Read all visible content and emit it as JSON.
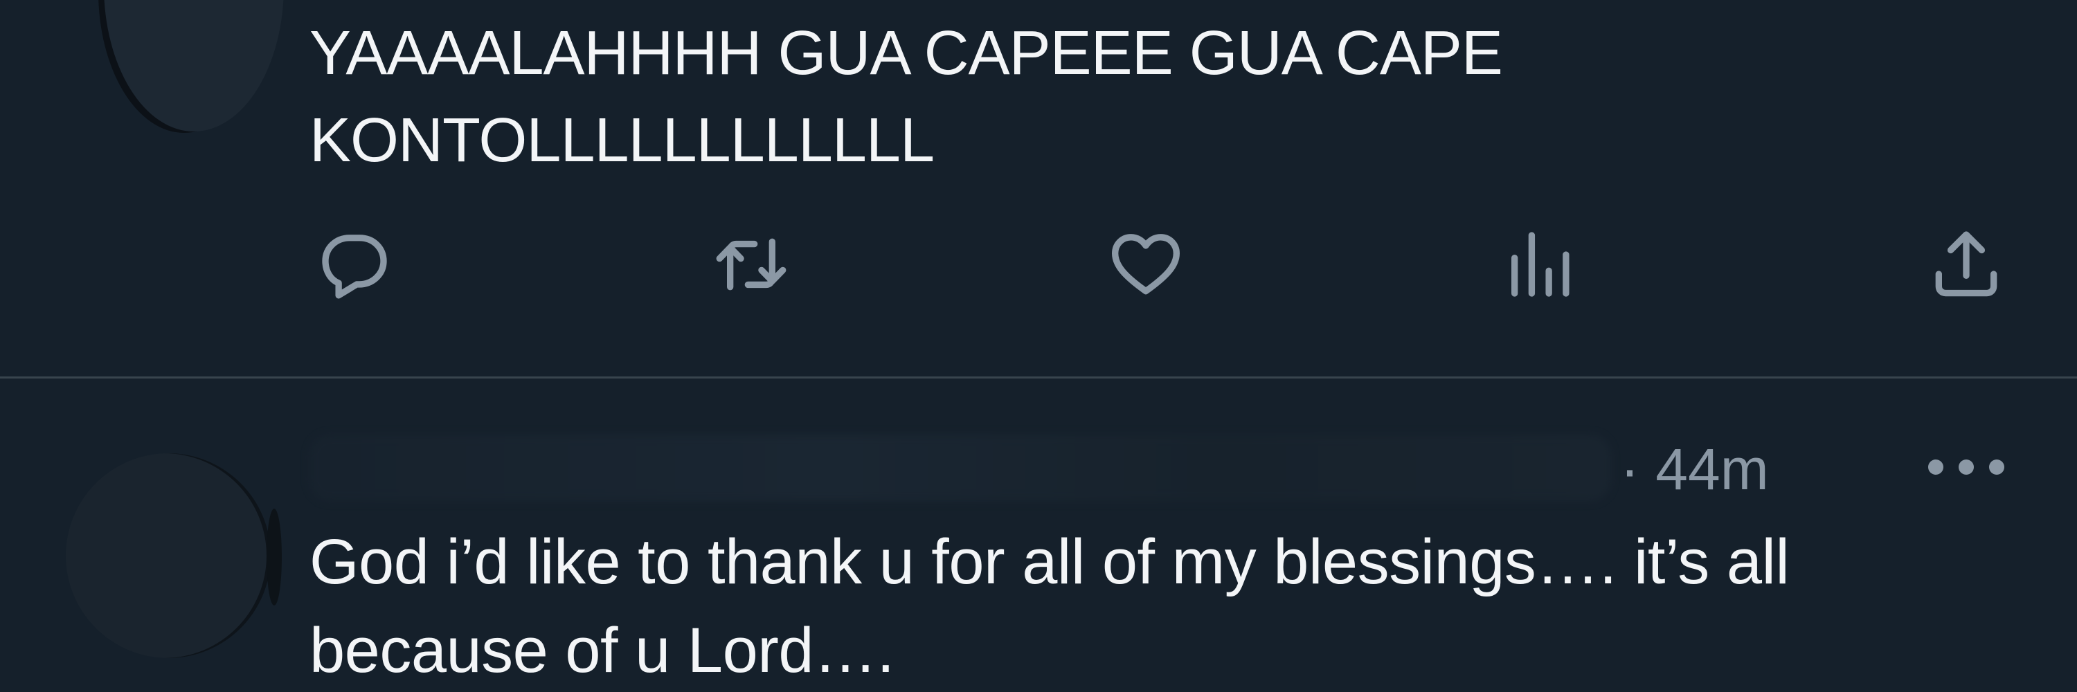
{
  "tweet1": {
    "text": "YAAAALAHHHH GUA CAPEEE GUA CAPE\nKONTOLLLLLLLLLLLL"
  },
  "actions": {
    "reply_icon": "reply-icon",
    "retweet_icon": "retweet-icon",
    "like_icon": "heart-icon",
    "views_icon": "views-icon",
    "share_icon": "share-icon",
    "icon_color": "#8b98a5"
  },
  "tweet2": {
    "time": "· 44m",
    "more_icon": "more-icon",
    "text": "God i’d like to thank u for all of my blessings…. it’s all because of u Lord…."
  },
  "colors": {
    "background": "#15202b",
    "divider": "#38444d",
    "text": "#f3f5f7",
    "muted": "#8b98a5"
  }
}
